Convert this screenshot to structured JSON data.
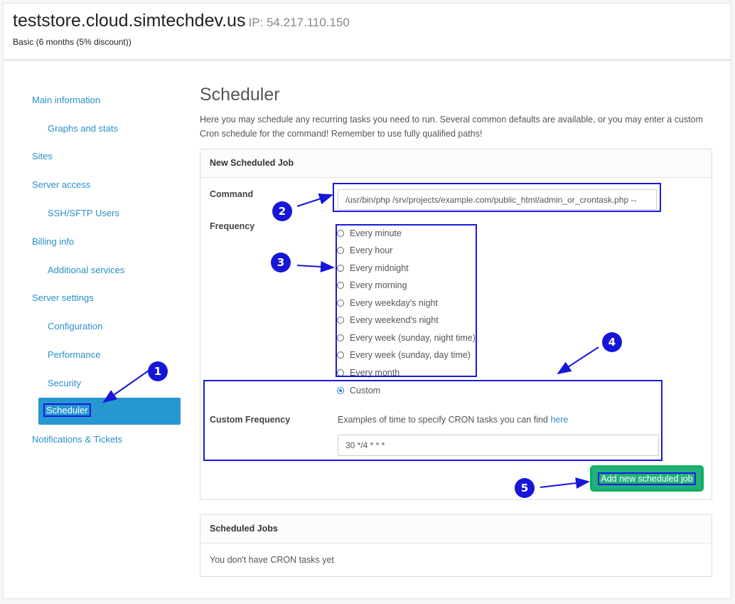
{
  "header": {
    "hostname": "teststore.cloud.simtechdev.us",
    "ip": "IP: 54.217.110.150",
    "plan": "Basic (6 months (5% discount))"
  },
  "sidebar": {
    "items": [
      {
        "label": "Main information"
      },
      {
        "label": "Graphs and stats"
      },
      {
        "label": "Sites"
      },
      {
        "label": "Server access"
      },
      {
        "label": "SSH/SFTP Users"
      },
      {
        "label": "Billing info"
      },
      {
        "label": "Additional services"
      },
      {
        "label": "Server settings"
      },
      {
        "label": "Configuration"
      },
      {
        "label": "Performance"
      },
      {
        "label": "Security"
      },
      {
        "label": "Scheduler"
      },
      {
        "label": "Notifications & Tickets"
      }
    ],
    "active": "Scheduler"
  },
  "page": {
    "title": "Scheduler",
    "intro": "Here you may schedule any recurring tasks you need to run. Several common defaults are available, or you may enter a custom Cron schedule for the command! Remember to use fully qualified paths!"
  },
  "new_job": {
    "heading": "New Scheduled Job",
    "command_label": "Command",
    "command_value": "/usr/bin/php /srv/projects/example.com/public_html/admin_or_crontask.php --",
    "frequency_label": "Frequency",
    "frequency_options": [
      "Every minute",
      "Every hour",
      "Every midnight",
      "Every morning",
      "Every weekday's night",
      "Every weekend's night",
      "Every week (sunday, night time)",
      "Every week (sunday, day time)",
      "Every month",
      "Custom"
    ],
    "selected_frequency": "Custom",
    "custom_label": "Custom Frequency",
    "examples_text": "Examples of time to specify CRON tasks you can find",
    "examples_link": "here",
    "custom_value": "30 */4 * * *",
    "add_button": "Add new scheduled job"
  },
  "scheduled_jobs": {
    "heading": "Scheduled Jobs",
    "empty": "You don't have CRON tasks yet"
  },
  "annotations": [
    "1",
    "2",
    "3",
    "4",
    "5"
  ],
  "colors": {
    "annotation": "#1616d9",
    "active_nav": "#2797d2",
    "button": "#21b07e",
    "link": "#2a90c9"
  }
}
